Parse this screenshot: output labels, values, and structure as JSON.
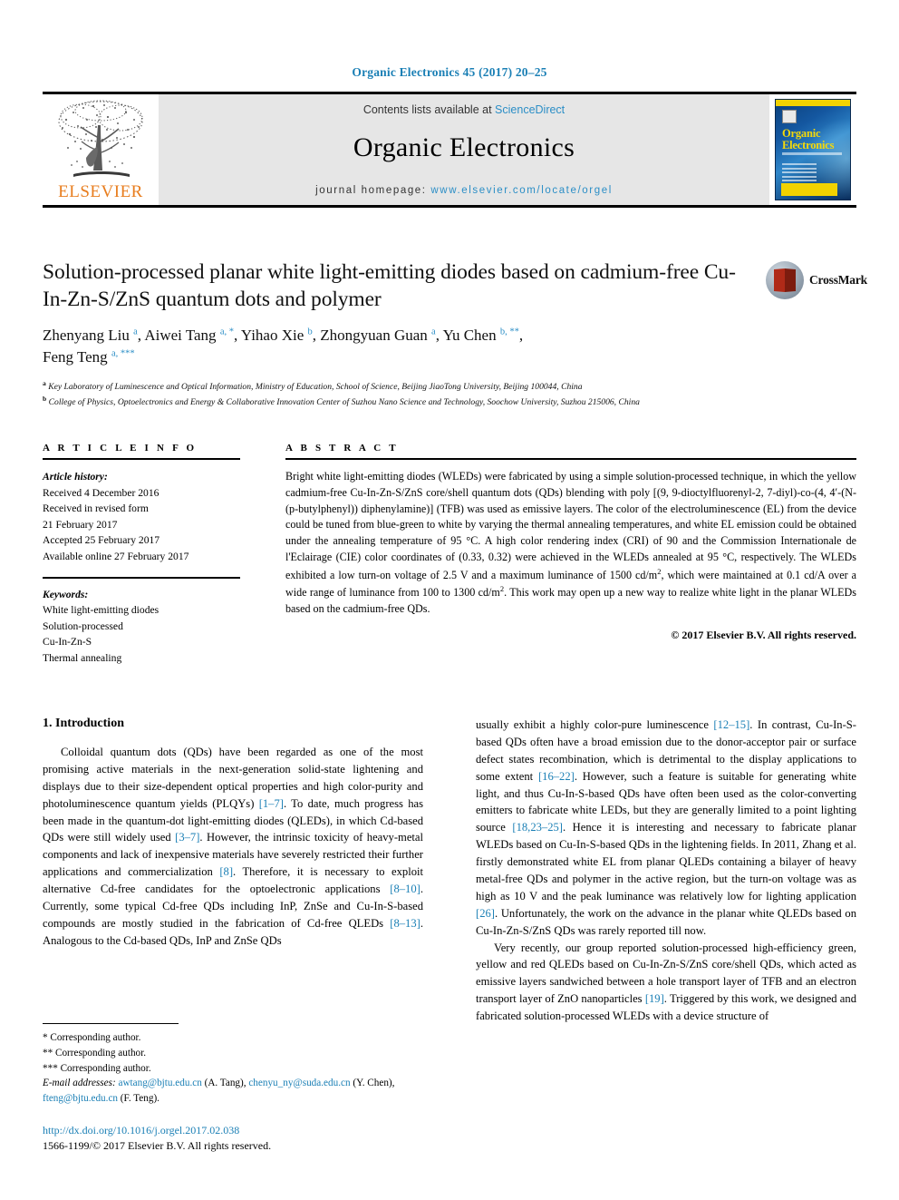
{
  "running_head": "Organic Electronics 45 (2017) 20–25",
  "masthead": {
    "logo_name": "ELSEVIER",
    "contents_prefix": "Contents lists available at",
    "contents_link": "ScienceDirect",
    "journal_name": "Organic Electronics",
    "homepage_prefix": "journal homepage:",
    "homepage_url": "www.elsevier.com/locate/orgel",
    "cover": {
      "title_line1": "Organic",
      "title_line2": "Electronics"
    }
  },
  "crossmark": {
    "label": "CrossMark"
  },
  "article": {
    "title": "Solution-processed planar white light-emitting diodes based on cadmium-free Cu-In-Zn-S/ZnS quantum dots and polymer",
    "authors_line1_a": "Zhenyang Liu ",
    "authors_sup1": "a",
    "authors_line1_b": ", Aiwei Tang ",
    "authors_sup2": "a, *",
    "authors_line1_c": ", Yihao Xie ",
    "authors_sup3": "b",
    "authors_line1_d": ", Zhongyuan Guan ",
    "authors_sup4": "a",
    "authors_line1_e": ", Yu Chen ",
    "authors_sup5": "b, **",
    "authors_line1_f": ",",
    "authors_line2_a": "Feng Teng ",
    "authors_sup6": "a, ***",
    "affiliation_a_sup": "a",
    "affiliation_a": "Key Laboratory of Luminescence and Optical Information, Ministry of Education, School of Science, Beijing JiaoTong University, Beijing 100044, China",
    "affiliation_b_sup": "b",
    "affiliation_b": "College of Physics, Optoelectronics and Energy & Collaborative Innovation Center of Suzhou Nano Science and Technology, Soochow University, Suzhou 215006, China"
  },
  "article_info": {
    "heading": "A R T I C L E   I N F O",
    "history_label": "Article history:",
    "history": [
      "Received 4 December 2016",
      "Received in revised form",
      "21 February 2017",
      "Accepted 25 February 2017",
      "Available online 27 February 2017"
    ],
    "keywords_label": "Keywords:",
    "keywords": [
      "White light-emitting diodes",
      "Solution-processed",
      "Cu-In-Zn-S",
      "Thermal annealing"
    ]
  },
  "abstract": {
    "heading": "A B S T R A C T",
    "part1": "Bright white light-emitting diodes (WLEDs) were fabricated by using a simple solution-processed technique, in which the yellow cadmium-free Cu-In-Zn-S/ZnS core/shell quantum dots (QDs) blending with poly [(9, 9-dioctylfluorenyl-2, 7-diyl)-co-(4, 4′-(N-(p-butylphenyl)) diphenylamine)] (TFB) was used as emissive layers. The color of the electroluminescence (EL) from the device could be tuned from blue-green to white by varying the thermal annealing temperatures, and white EL emission could be obtained under the annealing temperature of 95 °C. A high color rendering index (CRI) of 90 and the Commission Internationale de l'Eclairage (CIE) color coordinates of (0.33, 0.32) were achieved in the WLEDs annealed at 95 °C, respectively. The WLEDs exhibited a low turn-on voltage of 2.5 V and a maximum luminance of 1500 cd/m",
    "sup1": "2",
    "part2": ", which were maintained at 0.1 cd/A over a wide range of luminance from 100 to 1300 cd/m",
    "sup2": "2",
    "part3": ". This work may open up a new way to realize white light in the planar WLEDs based on the cadmium-free QDs.",
    "copyright": "© 2017 Elsevier B.V. All rights reserved."
  },
  "introduction": {
    "heading": "1. Introduction",
    "left_p1_a": "Colloidal quantum dots (QDs) have been regarded as one of the most promising active materials in the next-generation solid-state lightening and displays due to their size-dependent optical properties and high color-purity and photoluminescence quantum yields (PLQYs) ",
    "left_cite1": "[1–7]",
    "left_p1_b": ". To date, much progress has been made in the quantum-dot light-emitting diodes (QLEDs), in which Cd-based QDs were still widely used ",
    "left_cite2": "[3–7]",
    "left_p1_c": ". However, the intrinsic toxicity of heavy-metal components and lack of inexpensive materials have severely restricted their further applications and commercialization ",
    "left_cite3": "[8]",
    "left_p1_d": ". Therefore, it is necessary to exploit alternative Cd-free candidates for the optoelectronic applications ",
    "left_cite4": "[8–10]",
    "left_p1_e": ". Currently, some typical Cd-free QDs including InP, ZnSe and Cu-In-S-based compounds are mostly studied in the fabrication of Cd-free QLEDs ",
    "left_cite5": "[8–13]",
    "left_p1_f": ". Analogous to the Cd-based QDs, InP and ZnSe QDs",
    "right_p1_a": "usually exhibit a highly color-pure luminescence ",
    "right_cite1": "[12–15]",
    "right_p1_b": ". In contrast, Cu-In-S-based QDs often have a broad emission due to the donor-acceptor pair or surface defect states recombination, which is detrimental to the display applications to some extent ",
    "right_cite2": "[16–22]",
    "right_p1_c": ". However, such a feature is suitable for generating white light, and thus Cu-In-S-based QDs have often been used as the color-converting emitters to fabricate white LEDs, but they are generally limited to a point lighting source ",
    "right_cite3": "[18,23–25]",
    "right_p1_d": ". Hence it is interesting and necessary to fabricate planar WLEDs based on Cu-In-S-based QDs in the lightening fields. In 2011, Zhang et al. firstly demonstrated white EL from planar QLEDs containing a bilayer of heavy metal-free QDs and polymer in the active region, but the turn-on voltage was as high as 10 V and the peak luminance was relatively low for lighting application ",
    "right_cite4": "[26]",
    "right_p1_e": ". Unfortunately, the work on the advance in the planar white QLEDs based on Cu-In-Zn-S/ZnS QDs was rarely reported till now.",
    "right_p2_a": "Very recently, our group reported solution-processed high-efficiency green, yellow and red QLEDs based on Cu-In-Zn-S/ZnS core/shell QDs, which acted as emissive layers sandwiched between a hole transport layer of TFB and an electron transport layer of ZnO nanoparticles ",
    "right_cite5": "[19]",
    "right_p2_b": ". Triggered by this work, we designed and fabricated solution-processed WLEDs with a device structure of"
  },
  "footnotes": {
    "corr1": "* Corresponding author.",
    "corr2": "** Corresponding author.",
    "corr3": "*** Corresponding author.",
    "email_label": "E-mail addresses:",
    "email1": "awtang@bjtu.edu.cn",
    "email1_owner": "(A. Tang),",
    "email2": "chenyu_ny@suda.edu.cn",
    "email2_owner": "(Y. Chen),",
    "email3": "fteng@bjtu.edu.cn",
    "email3_owner": "(F. Teng)."
  },
  "doi": {
    "url": "http://dx.doi.org/10.1016/j.orgel.2017.02.038",
    "issn_line": "1566-1199/© 2017 Elsevier B.V. All rights reserved."
  },
  "colors": {
    "link_blue": "#1a7fb5",
    "science_direct_blue": "#2b8ec6",
    "elsevier_orange": "#E87D1E",
    "masthead_gray": "#e6e6e6"
  }
}
